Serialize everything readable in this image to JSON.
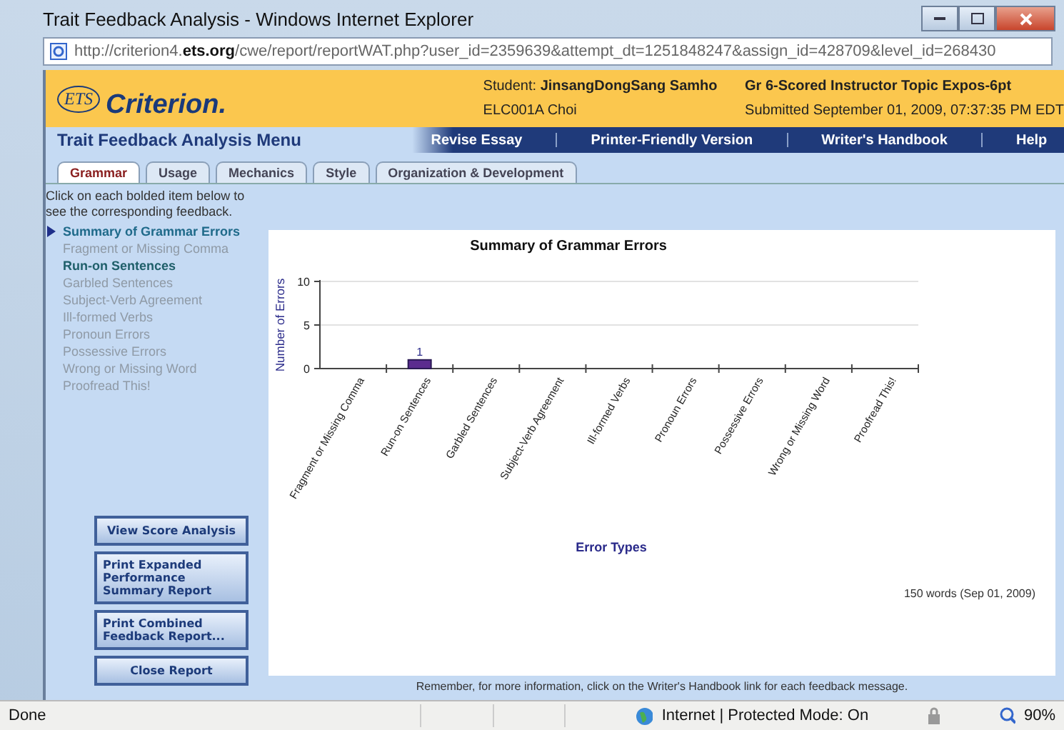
{
  "window": {
    "title": "Trait Feedback Analysis - Windows Internet Explorer"
  },
  "address_bar": {
    "url_prefix": "http://criterion4.",
    "url_domain": "ets.org",
    "url_rest": "/cwe/report/reportWAT.php?user_id=2359639&attempt_dt=1251848247&assign_id=428709&level_id=268430"
  },
  "header": {
    "logo_badge": "ETS",
    "logo_name": "Criterion.",
    "student_label": "Student:",
    "student_name": "JinsangDongSang Samho",
    "class_name": "ELC001A Choi",
    "assignment": "Gr 6-Scored Instructor Topic Expos-6pt",
    "submitted": "Submitted September 01, 2009, 07:37:35 PM EDT"
  },
  "menu_title": "Trait Feedback Analysis Menu",
  "nav_links": [
    "Revise Essay",
    "Printer-Friendly Version",
    "Writer's Handbook",
    "Help"
  ],
  "tabs": [
    {
      "label": "Grammar",
      "selected": true
    },
    {
      "label": "Usage",
      "selected": false
    },
    {
      "label": "Mechanics",
      "selected": false
    },
    {
      "label": "Style",
      "selected": false
    },
    {
      "label": "Organization & Development",
      "selected": false
    }
  ],
  "instructions": "Click on each bolded item below to see the corresponding feedback.",
  "feedback_items": [
    {
      "label": "Summary of Grammar Errors",
      "enabled": true,
      "selected": true
    },
    {
      "label": "Fragment or Missing Comma",
      "enabled": false,
      "selected": false
    },
    {
      "label": "Run-on Sentences",
      "enabled": true,
      "selected": false
    },
    {
      "label": "Garbled Sentences",
      "enabled": false,
      "selected": false
    },
    {
      "label": "Subject-Verb Agreement",
      "enabled": false,
      "selected": false
    },
    {
      "label": "Ill-formed Verbs",
      "enabled": false,
      "selected": false
    },
    {
      "label": "Pronoun Errors",
      "enabled": false,
      "selected": false
    },
    {
      "label": "Possessive Errors",
      "enabled": false,
      "selected": false
    },
    {
      "label": "Wrong or Missing Word",
      "enabled": false,
      "selected": false
    },
    {
      "label": "Proofread This!",
      "enabled": false,
      "selected": false
    }
  ],
  "side_buttons": [
    {
      "lines": [
        "View Score Analysis"
      ]
    },
    {
      "lines": [
        "Print Expanded",
        "Performance",
        "Summary Report"
      ]
    },
    {
      "lines": [
        "Print Combined",
        "Feedback Report..."
      ]
    },
    {
      "lines": [
        "Close Report"
      ]
    }
  ],
  "chart_data": {
    "type": "bar",
    "title": "Summary of Grammar Errors",
    "xlabel": "Error Types",
    "ylabel": "Number of Errors",
    "categories": [
      "Fragment or Missing Comma",
      "Run-on Sentences",
      "Garbled Sentences",
      "Subject-Verb Agreement",
      "Ill-formed Verbs",
      "Pronoun Errors",
      "Possessive Errors",
      "Wrong or Missing Word",
      "Proofread This!"
    ],
    "series": [
      {
        "color": "#5b2c8f",
        "values": [
          0,
          1,
          0,
          0,
          0,
          0,
          0,
          0,
          0
        ]
      }
    ],
    "ylim": [
      0,
      10
    ],
    "yticks": [
      0,
      5,
      10
    ],
    "value_labels": [
      null,
      "1",
      null,
      null,
      null,
      null,
      null,
      null,
      null
    ]
  },
  "word_count": "150 words (Sep 01, 2009)",
  "footer_note": "Remember, for more information, click on the Writer's Handbook link for each feedback message.",
  "status_bar": {
    "status": "Done",
    "zone": "Internet | Protected Mode: On",
    "zoom": "90%"
  }
}
